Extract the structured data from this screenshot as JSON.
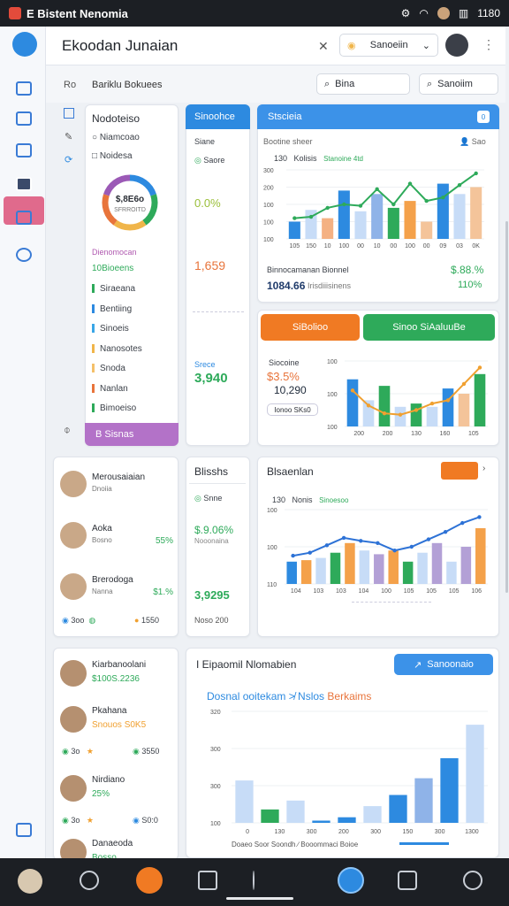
{
  "status": {
    "app_title": "E Bistent Nenomia",
    "time": "1180",
    "extra": "▥"
  },
  "header": {
    "title": "Ekoodan Junaian",
    "search_value": "Sanoeiin"
  },
  "subbar": {
    "crumb_prefix": "Ro",
    "crumb": "Bariklu Bokuees",
    "search1": "Bina",
    "search2": "Sanoiim"
  },
  "left_panel": {
    "title": "Nodoteiso",
    "row1": "Niamcoao",
    "row2": "Noidesa",
    "donut_value": "$,8E6o",
    "donut_sub": "SFRROITD",
    "section": "Dienomocan",
    "count_label": "10Bioeens",
    "items": [
      {
        "label": "Siraeana",
        "color": "#2eaa5a"
      },
      {
        "label": "Bentiing",
        "color": "#2d8ae0"
      },
      {
        "label": "Sinoeis",
        "color": "#3aa6e6"
      },
      {
        "label": "Nanosotes",
        "color": "#f0b54a"
      },
      {
        "label": "Snoda",
        "color": "#f4c06a"
      },
      {
        "label": "Nanlan",
        "color": "#e8743b"
      },
      {
        "label": "Bimoeiso",
        "color": "#2eaa5a"
      }
    ],
    "footer_button": "B Sisnas",
    "donut_colors": [
      "#2d8ae0",
      "#2eaa5a",
      "#f0b54a",
      "#e8743b",
      "#9b59b6"
    ]
  },
  "mid_panel": {
    "header": "Sinoohce",
    "label1": "Siane",
    "label2": "Saore",
    "value1": "0.0%",
    "value2": "1,659",
    "label3": "Srece",
    "value3": "3,940"
  },
  "chart1": {
    "title": "Stscieia",
    "subtitle": "Bootine sheer",
    "tag": "Sao",
    "chip": "0",
    "legend_num": "130",
    "legend_a": "Kolisis",
    "legend_b": "Stanoine 4td",
    "yticks": [
      "300",
      "200",
      "100",
      "100",
      "100"
    ],
    "xticks": [
      "105",
      "150",
      "10",
      "100",
      "00",
      "10",
      "00",
      "100",
      "00",
      "09",
      "03",
      "0K"
    ],
    "bars": [
      {
        "v": 0.25,
        "c": "#2d8ae0"
      },
      {
        "v": 0.42,
        "c": "#c7dcf7"
      },
      {
        "v": 0.3,
        "c": "#f4b183"
      },
      {
        "v": 0.7,
        "c": "#2d8ae0"
      },
      {
        "v": 0.4,
        "c": "#c7dcf7"
      },
      {
        "v": 0.65,
        "c": "#8fb3e8"
      },
      {
        "v": 0.45,
        "c": "#2eaa5a"
      },
      {
        "v": 0.55,
        "c": "#f4a14a"
      },
      {
        "v": 0.25,
        "c": "#f4c49a"
      },
      {
        "v": 0.8,
        "c": "#2d8ae0"
      },
      {
        "v": 0.65,
        "c": "#c7dcf7"
      },
      {
        "v": 0.75,
        "c": "#f4c49a"
      }
    ],
    "line": [
      0.3,
      0.32,
      0.45,
      0.5,
      0.48,
      0.72,
      0.5,
      0.8,
      0.55,
      0.6,
      0.78,
      0.95
    ],
    "foot_label": "Binnocamanan Bionnel",
    "foot_value": "$.88.%",
    "foot_left": "1084.66",
    "foot_mid": "Irisdiiisinens",
    "foot_right": "110%"
  },
  "chart2": {
    "btn_orange": "SiBolioo",
    "btn_green": "Sinoo SiAaluuBe",
    "label": "Siocoine",
    "big_value": "$3.5%",
    "sub_value": "10,290",
    "footer": "Ionoo SKs0",
    "yticks": [
      "100",
      "100",
      "100"
    ],
    "xticks": [
      "200",
      "200",
      "130",
      "160",
      "105"
    ],
    "bars": [
      {
        "v": 0.72,
        "c": "#2d8ae0"
      },
      {
        "v": 0.4,
        "c": "#c7dcf7"
      },
      {
        "v": 0.62,
        "c": "#2eaa5a"
      },
      {
        "v": 0.3,
        "c": "#c7dcf7"
      },
      {
        "v": 0.35,
        "c": "#2eaa5a"
      },
      {
        "v": 0.3,
        "c": "#c7dcf7"
      },
      {
        "v": 0.58,
        "c": "#2d8ae0"
      },
      {
        "v": 0.5,
        "c": "#f4c49a"
      },
      {
        "v": 0.8,
        "c": "#2eaa5a"
      }
    ],
    "line": [
      0.55,
      0.32,
      0.2,
      0.18,
      0.25,
      0.35,
      0.4,
      0.65,
      0.9
    ]
  },
  "people1": [
    {
      "name": "Merousaiaian",
      "role": "Dnoiia",
      "value": ""
    },
    {
      "name": "Aoka",
      "role": "Bosno",
      "value": "55%"
    },
    {
      "name": "Brerodoga",
      "role": "Nanna",
      "value": "$1.%"
    }
  ],
  "people1_footer": {
    "a": "3oo",
    "b": "1550"
  },
  "mid2": {
    "header": "Blisshs",
    "label1": "Snne",
    "value1": "$.9.06%",
    "label2": "Nooonaina",
    "value2": "3,9295",
    "label3": "Noso 200"
  },
  "chart3": {
    "title": "Blsaenlan",
    "legend_num": "130",
    "legend_a": "Nonis",
    "legend_b": "Sinoesoo",
    "yticks": [
      "100",
      "100",
      "110"
    ],
    "xticks": [
      "104",
      "103",
      "103",
      "104",
      "100",
      "105",
      "105",
      "105",
      "106"
    ],
    "bars": [
      {
        "v": 0.3,
        "c": "#2d8ae0"
      },
      {
        "v": 0.32,
        "c": "#f4a14a"
      },
      {
        "v": 0.35,
        "c": "#c7dcf7"
      },
      {
        "v": 0.42,
        "c": "#2eaa5a"
      },
      {
        "v": 0.55,
        "c": "#f4a14a"
      },
      {
        "v": 0.45,
        "c": "#c7dcf7"
      },
      {
        "v": 0.4,
        "c": "#b3a0d6"
      },
      {
        "v": 0.45,
        "c": "#f4a14a"
      },
      {
        "v": 0.3,
        "c": "#2eaa5a"
      },
      {
        "v": 0.42,
        "c": "#c7dcf7"
      },
      {
        "v": 0.55,
        "c": "#b3a0d6"
      },
      {
        "v": 0.3,
        "c": "#c7dcf7"
      },
      {
        "v": 0.5,
        "c": "#b3a0d6"
      },
      {
        "v": 0.75,
        "c": "#f4a14a"
      }
    ],
    "line": [
      0.38,
      0.42,
      0.52,
      0.62,
      0.58,
      0.55,
      0.45,
      0.5,
      0.6,
      0.7,
      0.82,
      0.9
    ]
  },
  "people2": [
    {
      "name": "Kiarbanoolani",
      "value": "$100S.2236"
    },
    {
      "name": "Pkahana",
      "value": "Snouos S0K5"
    },
    {
      "name": "Nirdiano",
      "value": "25%"
    },
    {
      "name": "Danaeoda",
      "value": "Bosso"
    }
  ],
  "people2_row": {
    "a": "3o",
    "b": "3550",
    "c": "S0:0"
  },
  "chart4": {
    "title": "I Eipaomil Nlomabien",
    "button": "Sanoonaio",
    "subtitle_a": "Dosnal ooitekam ≯ Nslos",
    "subtitle_b": "Berkaims",
    "yticks": [
      "320",
      "300",
      "300",
      "100"
    ],
    "xticks": [
      "0",
      "130",
      "300",
      "200",
      "300",
      "150",
      "300",
      "1300"
    ],
    "footer": "Doaeo Soor Soondh ∕ Booommaci Boioe",
    "bars": [
      {
        "v": 0.38,
        "c": "#c7dcf7"
      },
      {
        "v": 0.12,
        "c": "#2eaa5a"
      },
      {
        "v": 0.2,
        "c": "#c7dcf7"
      },
      {
        "v": 0.02,
        "c": "#2d8ae0"
      },
      {
        "v": 0.05,
        "c": "#2d8ae0"
      },
      {
        "v": 0.15,
        "c": "#c7dcf7"
      },
      {
        "v": 0.25,
        "c": "#2d8ae0"
      },
      {
        "v": 0.4,
        "c": "#8fb3e8"
      },
      {
        "v": 0.58,
        "c": "#2d8ae0"
      },
      {
        "v": 0.88,
        "c": "#c7dcf7"
      }
    ]
  },
  "bottom": {
    "items": [
      "",
      "",
      "",
      "",
      "",
      "",
      "",
      ""
    ]
  }
}
